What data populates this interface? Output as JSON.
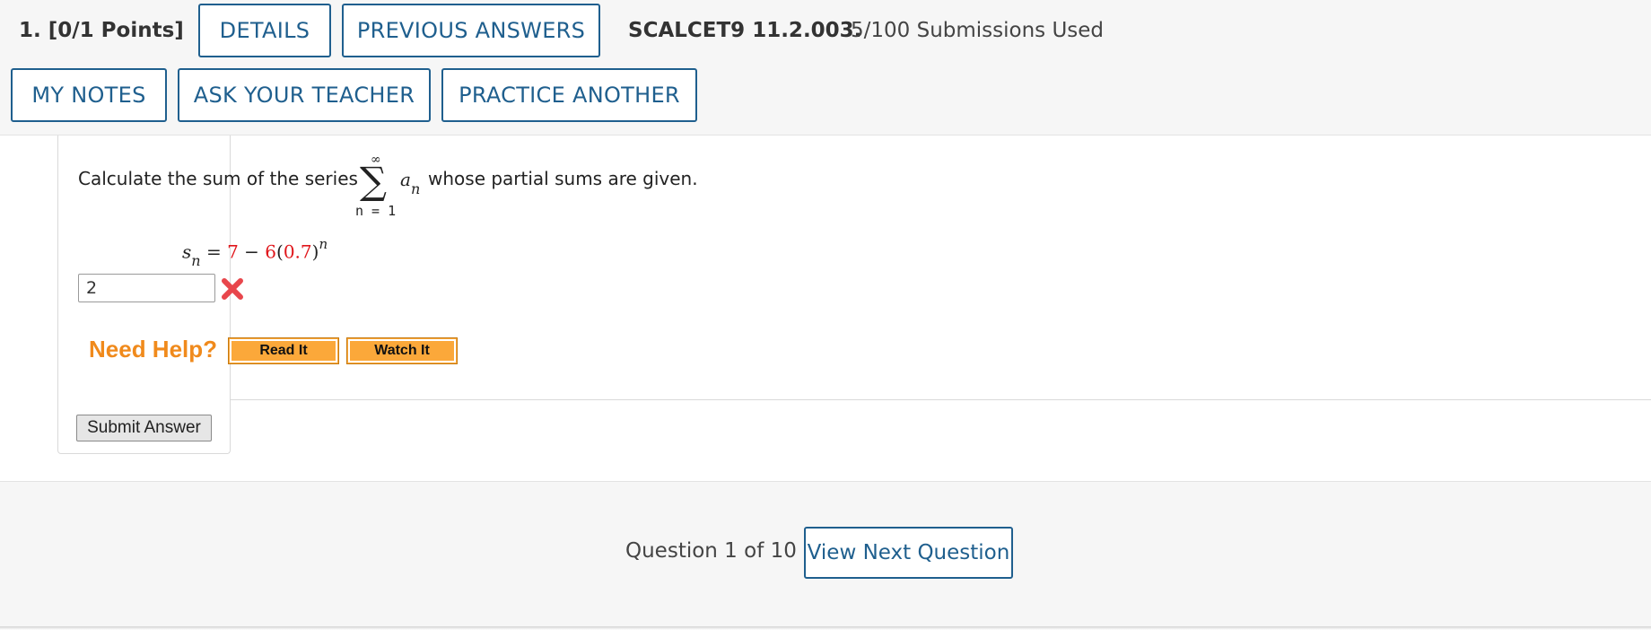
{
  "header": {
    "question_label": "1.  [0/1 Points]",
    "details_label": "DETAILS",
    "previous_answers_label": "PREVIOUS ANSWERS",
    "problem_code": "SCALCET9 11.2.003.",
    "submissions": "5/100 Submissions Used",
    "my_notes_label": "MY NOTES",
    "ask_teacher_label": "ASK YOUR TEACHER",
    "practice_label": "PRACTICE ANOTHER"
  },
  "question": {
    "prompt_before": "Calculate the sum of the series",
    "prompt_after": "whose partial sums are given.",
    "sum_upper": "∞",
    "sum_symbol": "∑",
    "sum_lower": "n = 1",
    "term_var": "a",
    "term_sub": "n",
    "partial_var": "s",
    "partial_sub": "n",
    "eq": "=",
    "const": "7",
    "minus": "−",
    "coef": "6",
    "open_paren": "(",
    "base": "0.7",
    "close_paren": ")",
    "exponent": "n"
  },
  "answer": {
    "value": "2",
    "status_icon": "x-icon",
    "status": "incorrect"
  },
  "help": {
    "label": "Need Help?",
    "read_label": "Read It",
    "watch_label": "Watch It"
  },
  "submit_label": "Submit Answer",
  "footer": {
    "progress": "Question 1 of 10",
    "next_label": "View Next Question"
  },
  "colors": {
    "accent": "#1f5f8e",
    "highlight_red": "#e0161b",
    "help_orange": "#f08a1c",
    "help_button": "#fba83a",
    "error_x": "#e8464c"
  }
}
